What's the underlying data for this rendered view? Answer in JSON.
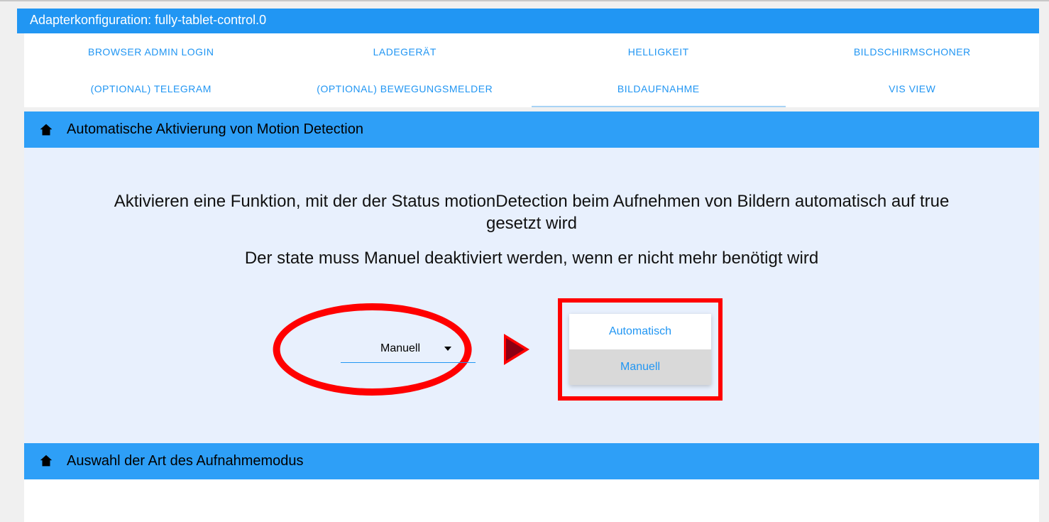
{
  "header": {
    "title": "Adapterkonfiguration: fully-tablet-control.0"
  },
  "tabs": {
    "row1": [
      {
        "label": "BROWSER ADMIN LOGIN"
      },
      {
        "label": "LADEGERÄT"
      },
      {
        "label": "HELLIGKEIT"
      },
      {
        "label": "BILDSCHIRMSCHONER"
      }
    ],
    "row2": [
      {
        "label": "(OPTIONAL) TELEGRAM"
      },
      {
        "label": "(OPTIONAL) BEWEGUNGSMELDER"
      },
      {
        "label": "BILDAUFNAHME",
        "active": true
      },
      {
        "label": "VIS VIEW"
      }
    ]
  },
  "section1": {
    "title": "Automatische Aktivierung von Motion Detection",
    "line1": "Aktivieren eine Funktion, mit der der Status motionDetection beim Aufnehmen von Bildern automatisch auf true gesetzt wird",
    "line2": "Der state muss Manuel deaktiviert werden, wenn er nicht mehr benötigt wird",
    "select": {
      "value": "Manuell",
      "options": [
        {
          "label": "Automatisch",
          "selected": false
        },
        {
          "label": "Manuell",
          "selected": true
        }
      ]
    }
  },
  "section2": {
    "title": "Auswahl der Art des Aufnahmemodus"
  }
}
